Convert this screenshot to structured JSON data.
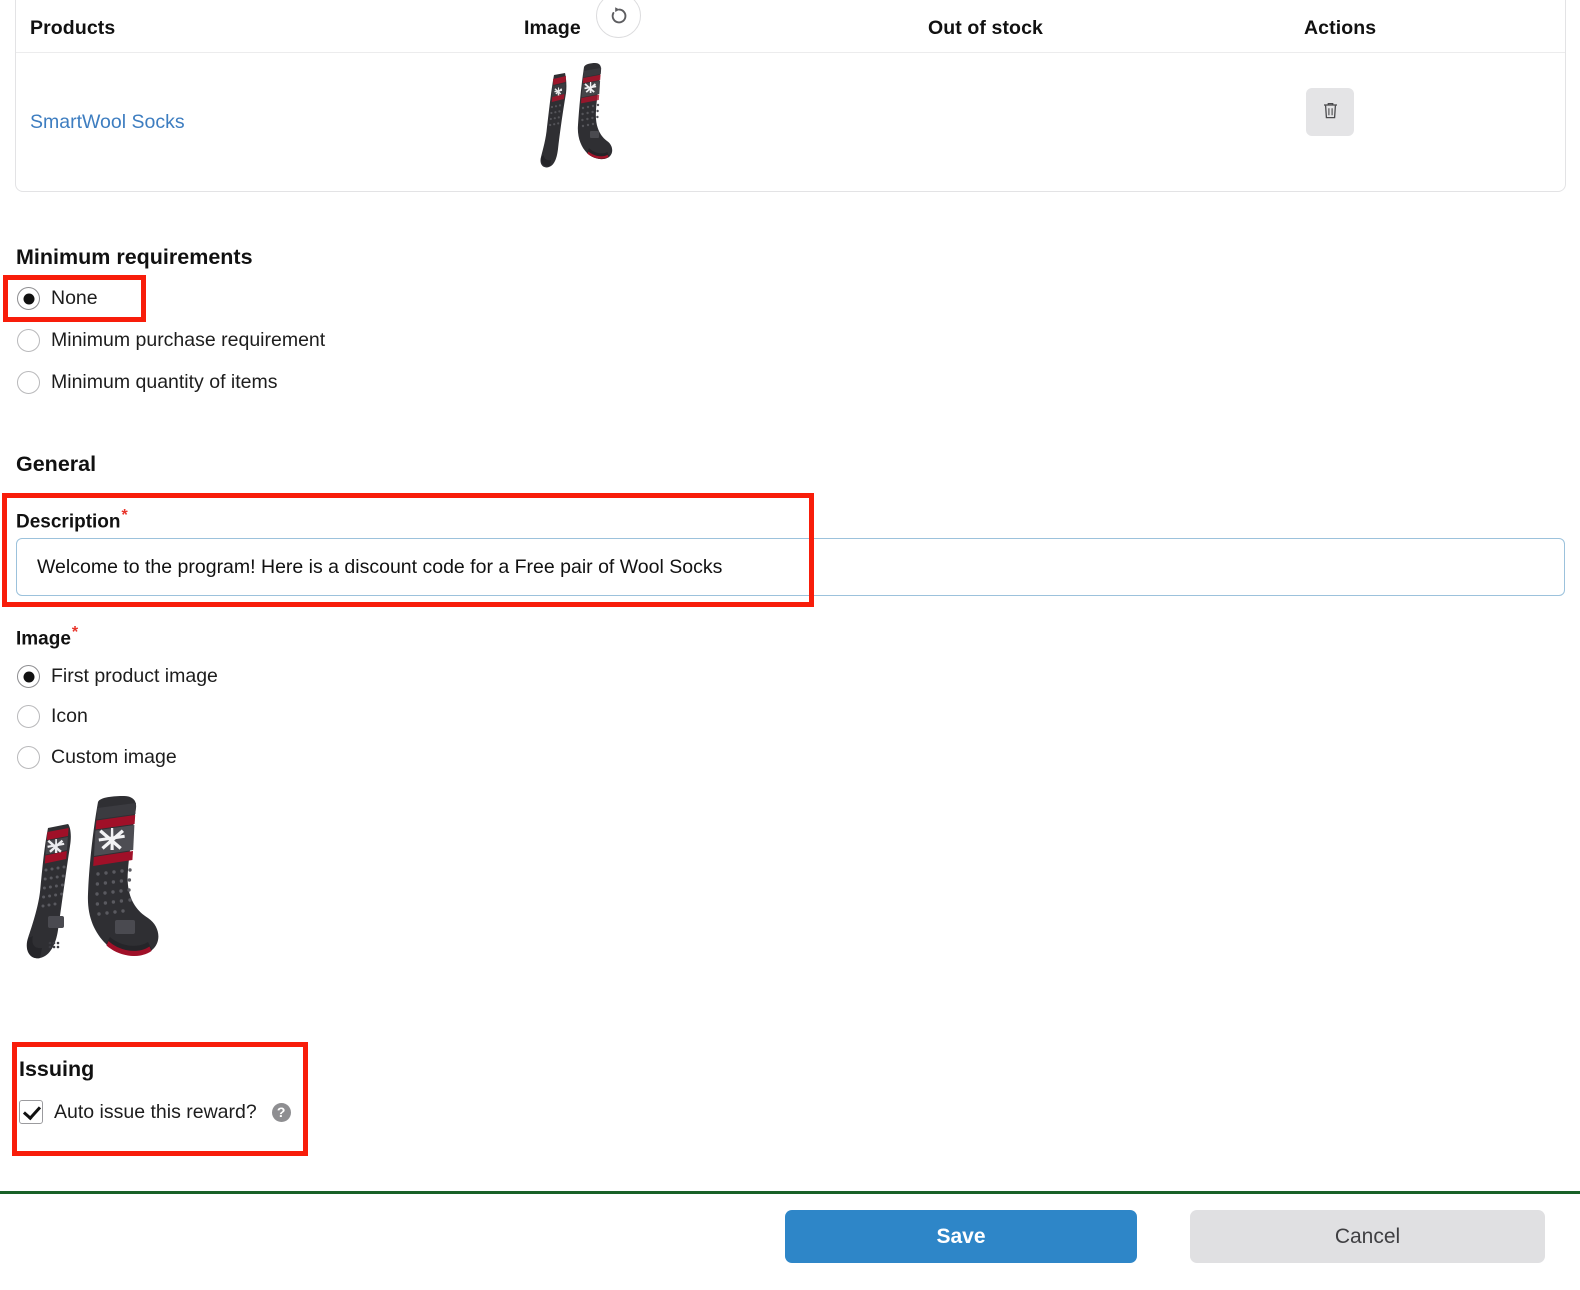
{
  "products_table": {
    "columns": {
      "products": "Products",
      "image": "Image",
      "out_of_stock": "Out of stock",
      "actions": "Actions"
    },
    "refresh_icon": "refresh-icon",
    "rows": [
      {
        "name": "SmartWool Socks",
        "image_alt": "product-thumbnail-smartwool-socks",
        "out_of_stock": "",
        "action_icon": "trash-icon"
      }
    ]
  },
  "minimum_requirements": {
    "title": "Minimum requirements",
    "options": [
      {
        "label": "None",
        "checked": true
      },
      {
        "label": "Minimum purchase requirement",
        "checked": false
      },
      {
        "label": "Minimum quantity of items",
        "checked": false
      }
    ]
  },
  "general": {
    "title": "General",
    "description": {
      "label": "Description",
      "required_marker": "*",
      "value": "Welcome to the program! Here is a discount code for a Free pair of Wool Socks",
      "placeholder": ""
    },
    "image": {
      "label": "Image",
      "required_marker": "*",
      "options": [
        {
          "label": "First product image",
          "checked": true
        },
        {
          "label": "Icon",
          "checked": false
        },
        {
          "label": "Custom image",
          "checked": false
        }
      ],
      "preview_alt": "reward-image-preview-smartwool-socks"
    }
  },
  "issuing": {
    "title": "Issuing",
    "auto_issue": {
      "label": "Auto issue this reward?",
      "checked": true,
      "help_icon": "help-circle-icon",
      "help_glyph": "?"
    }
  },
  "footer": {
    "save_label": "Save",
    "cancel_label": "Cancel"
  },
  "colors": {
    "accent_blue": "#2e86c8",
    "link_blue": "#3d7dc0",
    "highlight_red": "#f81d0a",
    "required_red": "#e8342a",
    "footer_rule_green": "#186128",
    "cancel_gray": "#e0e0e2"
  }
}
